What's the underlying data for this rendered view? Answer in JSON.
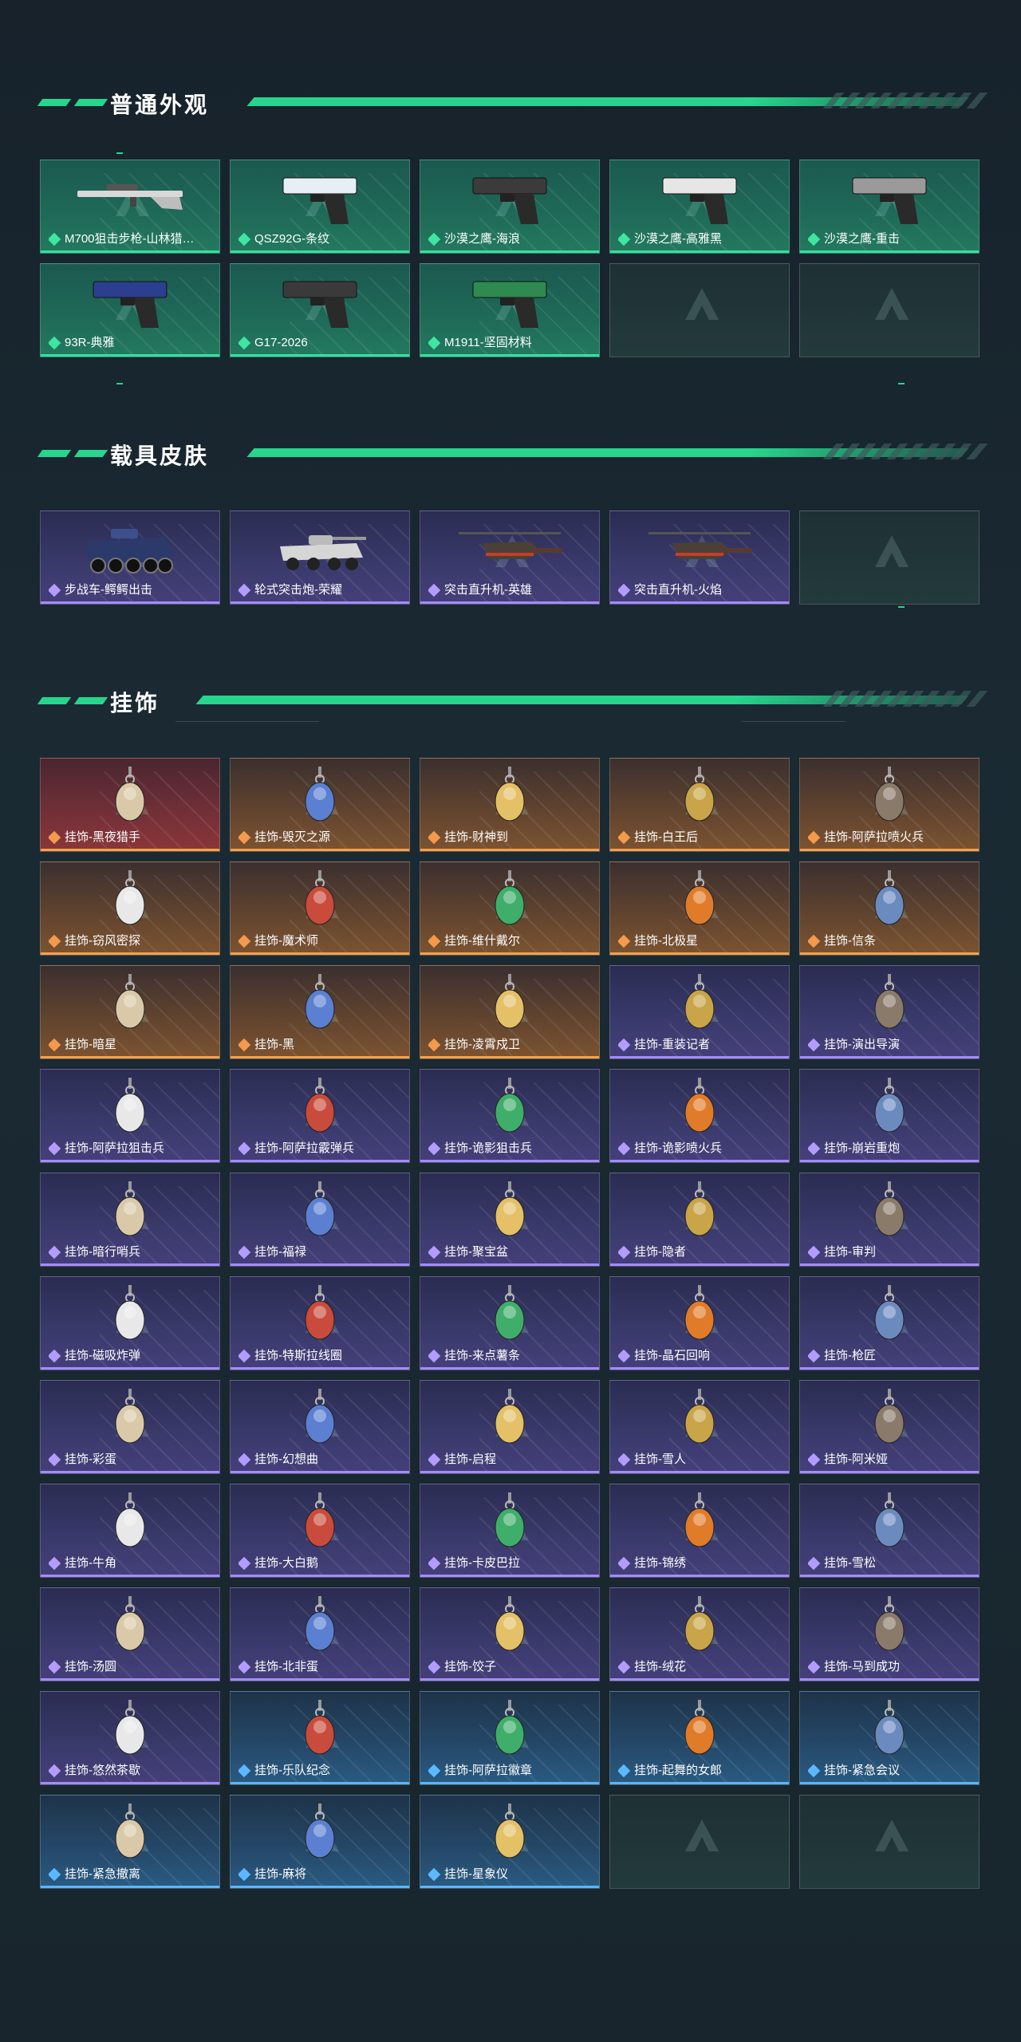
{
  "colors": {
    "accent": "#27d58c",
    "green": "#2fe39a",
    "purple": "#a48bff",
    "orange": "#f4a14b",
    "blue": "#58b6ff"
  },
  "sections": {
    "weapon": {
      "title": "普通外观"
    },
    "vehicle": {
      "title": "载具皮肤"
    },
    "charm": {
      "title": "挂饰"
    }
  },
  "weapons": [
    {
      "label": "M700狙击步枪-山林猎…",
      "icon": "sniper-rifle-icon",
      "rarity": "green"
    },
    {
      "label": "QSZ92G-条纹",
      "icon": "pistol-icon",
      "rarity": "green"
    },
    {
      "label": "沙漠之鹰-海浪",
      "icon": "pistol-icon",
      "rarity": "green"
    },
    {
      "label": "沙漠之鹰-高雅黑",
      "icon": "pistol-icon",
      "rarity": "green"
    },
    {
      "label": "沙漠之鹰-重击",
      "icon": "pistol-icon",
      "rarity": "green"
    },
    {
      "label": "93R-典雅",
      "icon": "pistol-icon",
      "rarity": "green"
    },
    {
      "label": "G17-2026",
      "icon": "pistol-icon",
      "rarity": "green"
    },
    {
      "label": "M1911-坚固材料",
      "icon": "pistol-icon",
      "rarity": "green"
    }
  ],
  "vehicles": [
    {
      "label": "步战车-鳄鳄出击",
      "icon": "ifv-icon",
      "rarity": "purple"
    },
    {
      "label": "轮式突击炮-荣耀",
      "icon": "assault-gun-icon",
      "rarity": "purple"
    },
    {
      "label": "突击直升机-英雄",
      "icon": "helicopter-icon",
      "rarity": "purple"
    },
    {
      "label": "突击直升机-火焰",
      "icon": "helicopter-icon",
      "rarity": "purple"
    }
  ],
  "charms": [
    {
      "label": "挂饰-黑夜猎手",
      "rarity": "red"
    },
    {
      "label": "挂饰-毁灭之源",
      "rarity": "orange"
    },
    {
      "label": "挂饰-财神到",
      "rarity": "orange"
    },
    {
      "label": "挂饰-白王后",
      "rarity": "orange"
    },
    {
      "label": "挂饰-阿萨拉喷火兵",
      "rarity": "orange"
    },
    {
      "label": "挂饰-窃风密探",
      "rarity": "orange"
    },
    {
      "label": "挂饰-魔术师",
      "rarity": "orange"
    },
    {
      "label": "挂饰-维什戴尔",
      "rarity": "orange"
    },
    {
      "label": "挂饰-北极星",
      "rarity": "orange"
    },
    {
      "label": "挂饰-信条",
      "rarity": "orange"
    },
    {
      "label": "挂饰-暗星",
      "rarity": "orange"
    },
    {
      "label": "挂饰-黑",
      "rarity": "orange"
    },
    {
      "label": "挂饰-凌霄戍卫",
      "rarity": "orange"
    },
    {
      "label": "挂饰-重装记者",
      "rarity": "purple"
    },
    {
      "label": "挂饰-演出导演",
      "rarity": "purple"
    },
    {
      "label": "挂饰-阿萨拉狙击兵",
      "rarity": "purple"
    },
    {
      "label": "挂饰-阿萨拉霰弹兵",
      "rarity": "purple"
    },
    {
      "label": "挂饰-诡影狙击兵",
      "rarity": "purple"
    },
    {
      "label": "挂饰-诡影喷火兵",
      "rarity": "purple"
    },
    {
      "label": "挂饰-崩岩重炮",
      "rarity": "purple"
    },
    {
      "label": "挂饰-暗行哨兵",
      "rarity": "purple"
    },
    {
      "label": "挂饰-福禄",
      "rarity": "purple"
    },
    {
      "label": "挂饰-聚宝盆",
      "rarity": "purple"
    },
    {
      "label": "挂饰-隐者",
      "rarity": "purple"
    },
    {
      "label": "挂饰-审判",
      "rarity": "purple"
    },
    {
      "label": "挂饰-磁吸炸弹",
      "rarity": "purple"
    },
    {
      "label": "挂饰-特斯拉线圈",
      "rarity": "purple"
    },
    {
      "label": "挂饰-来点薯条",
      "rarity": "purple"
    },
    {
      "label": "挂饰-晶石回响",
      "rarity": "purple"
    },
    {
      "label": "挂饰-枪匠",
      "rarity": "purple"
    },
    {
      "label": "挂饰-彩蛋",
      "rarity": "purple"
    },
    {
      "label": "挂饰-幻想曲",
      "rarity": "purple"
    },
    {
      "label": "挂饰-启程",
      "rarity": "purple"
    },
    {
      "label": "挂饰-雪人",
      "rarity": "purple"
    },
    {
      "label": "挂饰-阿米娅",
      "rarity": "purple"
    },
    {
      "label": "挂饰-牛角",
      "rarity": "purple"
    },
    {
      "label": "挂饰-大白鹅",
      "rarity": "purple"
    },
    {
      "label": "挂饰-卡皮巴拉",
      "rarity": "purple"
    },
    {
      "label": "挂饰-锦绣",
      "rarity": "purple"
    },
    {
      "label": "挂饰-雪松",
      "rarity": "purple"
    },
    {
      "label": "挂饰-汤圆",
      "rarity": "purple"
    },
    {
      "label": "挂饰-北非蛋",
      "rarity": "purple"
    },
    {
      "label": "挂饰-饺子",
      "rarity": "purple"
    },
    {
      "label": "挂饰-绒花",
      "rarity": "purple"
    },
    {
      "label": "挂饰-马到成功",
      "rarity": "purple"
    },
    {
      "label": "挂饰-悠然茶歇",
      "rarity": "purple"
    },
    {
      "label": "挂饰-乐队纪念",
      "rarity": "blue"
    },
    {
      "label": "挂饰-阿萨拉徽章",
      "rarity": "blue"
    },
    {
      "label": "挂饰-起舞的女郎",
      "rarity": "blue"
    },
    {
      "label": "挂饰-紧急会议",
      "rarity": "blue"
    },
    {
      "label": "挂饰-紧急撤离",
      "rarity": "blue"
    },
    {
      "label": "挂饰-麻将",
      "rarity": "blue"
    },
    {
      "label": "挂饰-星象仪",
      "rarity": "blue"
    }
  ]
}
